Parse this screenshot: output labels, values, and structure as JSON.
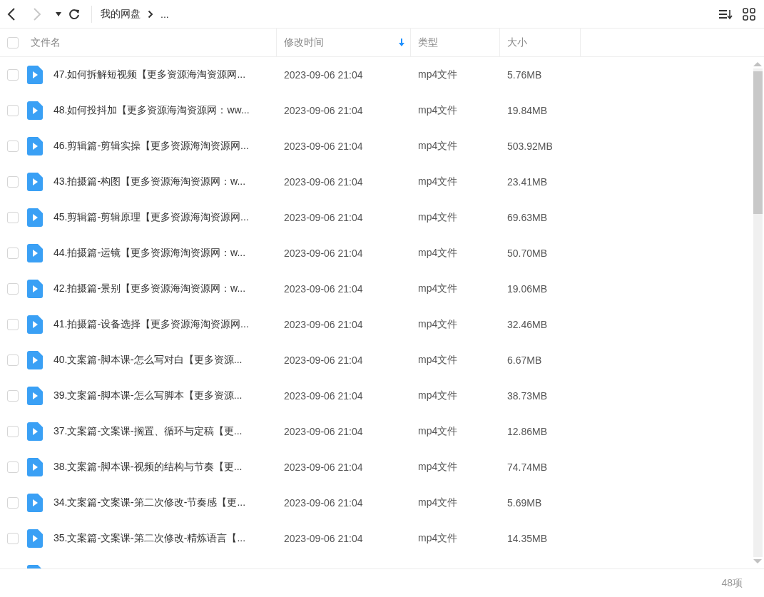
{
  "toolbar": {
    "breadcrumb": [
      {
        "label": "我的网盘"
      },
      {
        "label": "..."
      }
    ]
  },
  "table": {
    "select_all": {
      "checked": false
    },
    "columns": [
      {
        "label": "文件名",
        "sorted": false
      },
      {
        "label": "修改时间",
        "sorted": true
      },
      {
        "label": "类型",
        "sorted": false
      },
      {
        "label": "大小",
        "sorted": false
      }
    ],
    "rows": [
      {
        "name": "47.如何拆解短视频【更多资源海淘资源网...",
        "time": "2023-09-06 21:04",
        "type": "mp4文件",
        "size": "5.76MB",
        "selected": false
      },
      {
        "name": "48.如何投抖加【更多资源海淘资源网：ww...",
        "time": "2023-09-06 21:04",
        "type": "mp4文件",
        "size": "19.84MB",
        "selected": false
      },
      {
        "name": "46.剪辑篇-剪辑实操【更多资源海淘资源网...",
        "time": "2023-09-06 21:04",
        "type": "mp4文件",
        "size": "503.92MB",
        "selected": false
      },
      {
        "name": "43.拍摄篇-构图【更多资源海淘资源网：w...",
        "time": "2023-09-06 21:04",
        "type": "mp4文件",
        "size": "23.41MB",
        "selected": false
      },
      {
        "name": "45.剪辑篇-剪辑原理【更多资源海淘资源网...",
        "time": "2023-09-06 21:04",
        "type": "mp4文件",
        "size": "69.63MB",
        "selected": false
      },
      {
        "name": "44.拍摄篇-运镜【更多资源海淘资源网：w...",
        "time": "2023-09-06 21:04",
        "type": "mp4文件",
        "size": "50.70MB",
        "selected": false
      },
      {
        "name": "42.拍摄篇-景别【更多资源海淘资源网：w...",
        "time": "2023-09-06 21:04",
        "type": "mp4文件",
        "size": "19.06MB",
        "selected": false
      },
      {
        "name": "41.拍摄篇-设备选择【更多资源海淘资源网...",
        "time": "2023-09-06 21:04",
        "type": "mp4文件",
        "size": "32.46MB",
        "selected": false
      },
      {
        "name": "40.文案篇-脚本课-怎么写对白【更多资源...",
        "time": "2023-09-06 21:04",
        "type": "mp4文件",
        "size": "6.67MB",
        "selected": false
      },
      {
        "name": "39.文案篇-脚本课-怎么写脚本【更多资源...",
        "time": "2023-09-06 21:04",
        "type": "mp4文件",
        "size": "38.73MB",
        "selected": false
      },
      {
        "name": "37.文案篇-文案课-搁置、循环与定稿【更...",
        "time": "2023-09-06 21:04",
        "type": "mp4文件",
        "size": "12.86MB",
        "selected": false
      },
      {
        "name": "38.文案篇-脚本课-视频的结构与节奏【更...",
        "time": "2023-09-06 21:04",
        "type": "mp4文件",
        "size": "74.74MB",
        "selected": false
      },
      {
        "name": "34.文案篇-文案课-第二次修改-节奏感【更...",
        "time": "2023-09-06 21:04",
        "type": "mp4文件",
        "size": "5.69MB",
        "selected": false
      },
      {
        "name": "35.文案篇-文案课-第二次修改-精炼语言【...",
        "time": "2023-09-06 21:04",
        "type": "mp4文件",
        "size": "14.35MB",
        "selected": false
      }
    ]
  },
  "status_bar": {
    "count": "48项"
  }
}
